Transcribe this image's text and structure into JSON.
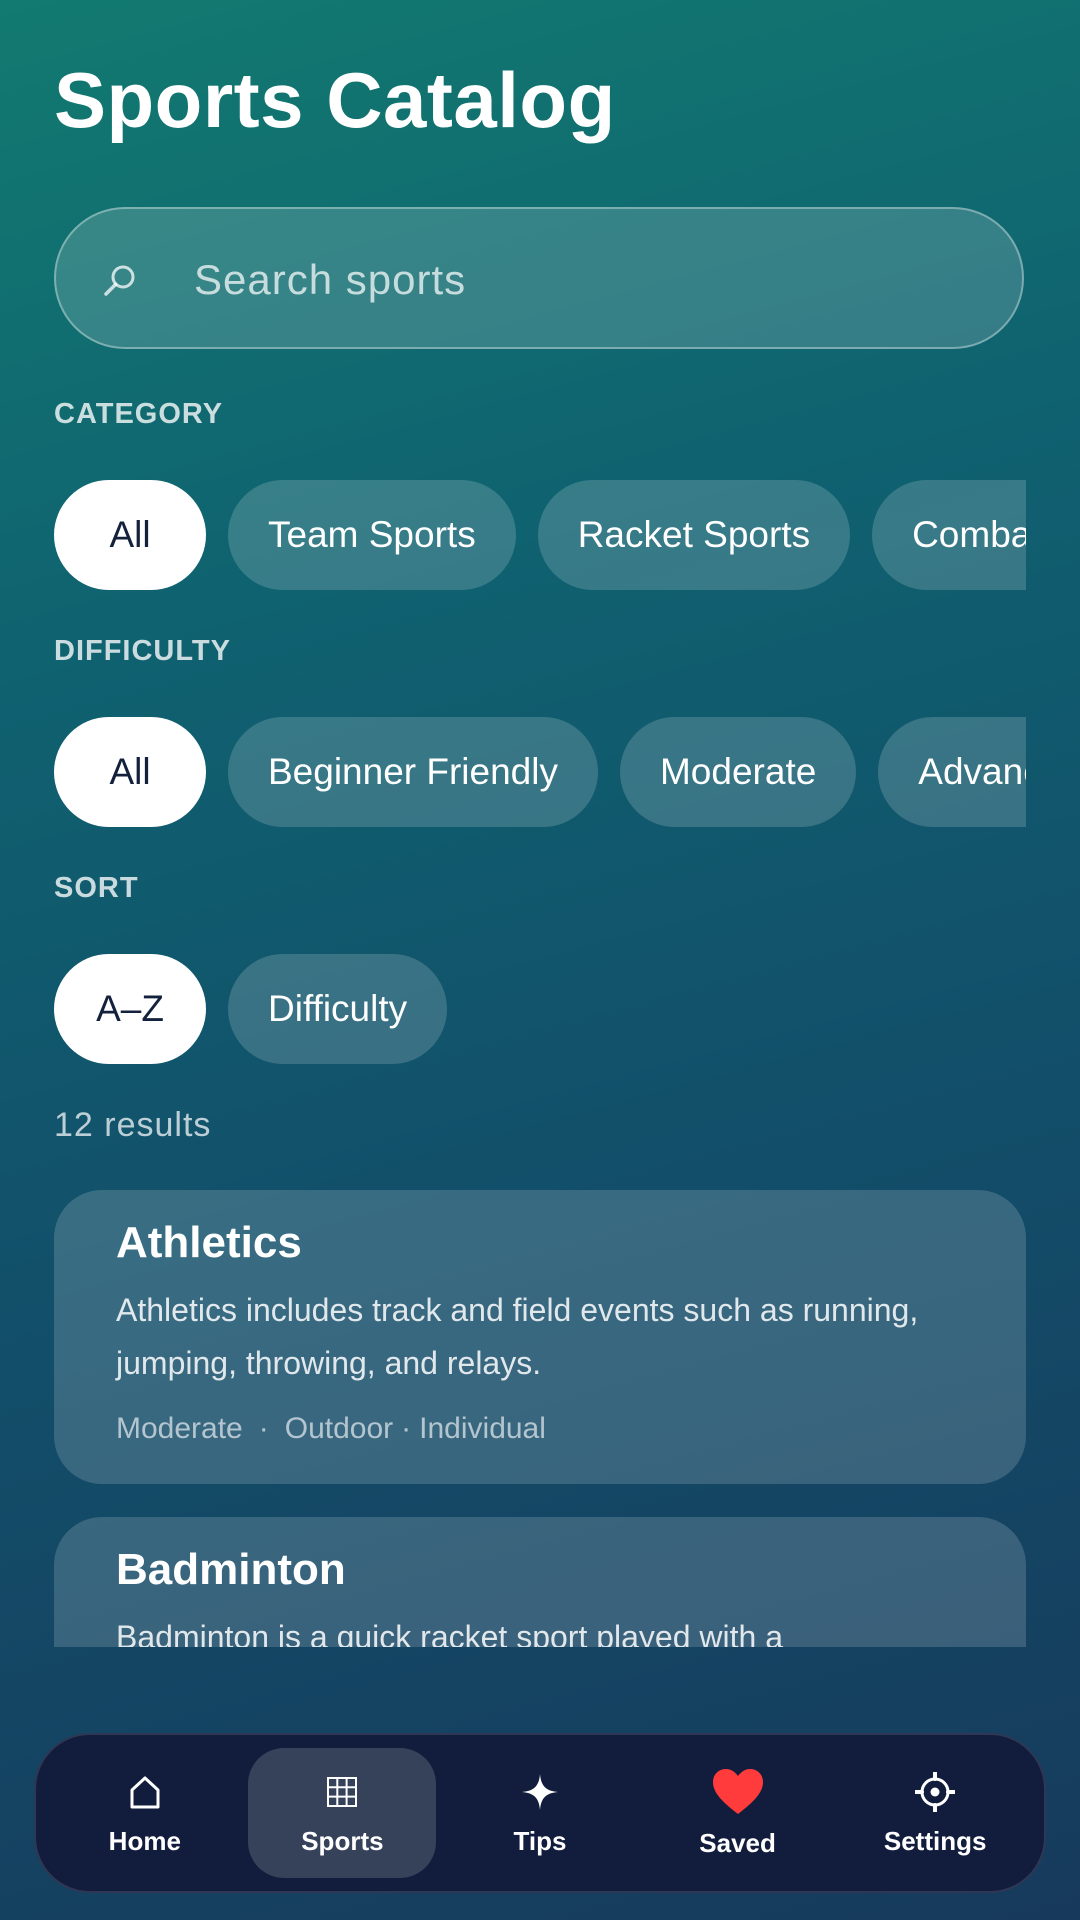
{
  "header": {
    "title": "Sports Catalog"
  },
  "search": {
    "placeholder": "Search sports",
    "value": ""
  },
  "filters": {
    "category": {
      "label": "CATEGORY",
      "options": [
        "All",
        "Team Sports",
        "Racket Sports",
        "Combat"
      ],
      "selected": "All"
    },
    "difficulty": {
      "label": "DIFFICULTY",
      "options": [
        "All",
        "Beginner Friendly",
        "Moderate",
        "Advanced"
      ],
      "selected": "All"
    },
    "sort": {
      "label": "SORT",
      "options": [
        "A–Z",
        "Difficulty"
      ],
      "selected": "A–Z"
    }
  },
  "results": {
    "count_text": "12 results",
    "items": [
      {
        "title": "Athletics",
        "description": "Athletics includes track and field events such as running, jumping, throwing, and relays.",
        "difficulty": "Moderate",
        "setting": "Outdoor",
        "format": "Individual"
      },
      {
        "title": "Badminton",
        "description": "Badminton is a quick racket sport played with a"
      }
    ]
  },
  "nav": {
    "items": [
      {
        "label": "Home",
        "icon": "home-icon"
      },
      {
        "label": "Sports",
        "icon": "grid-icon",
        "active": true
      },
      {
        "label": "Tips",
        "icon": "sparkle-icon"
      },
      {
        "label": "Saved",
        "icon": "heart-icon"
      },
      {
        "label": "Settings",
        "icon": "gear-icon"
      }
    ]
  },
  "colors": {
    "gradient_top": "#127a70",
    "gradient_bottom": "#173a5c",
    "nav_background": "#121c3c",
    "chip_active_text": "#14213d",
    "saved_heart": "#ff3b3b"
  }
}
